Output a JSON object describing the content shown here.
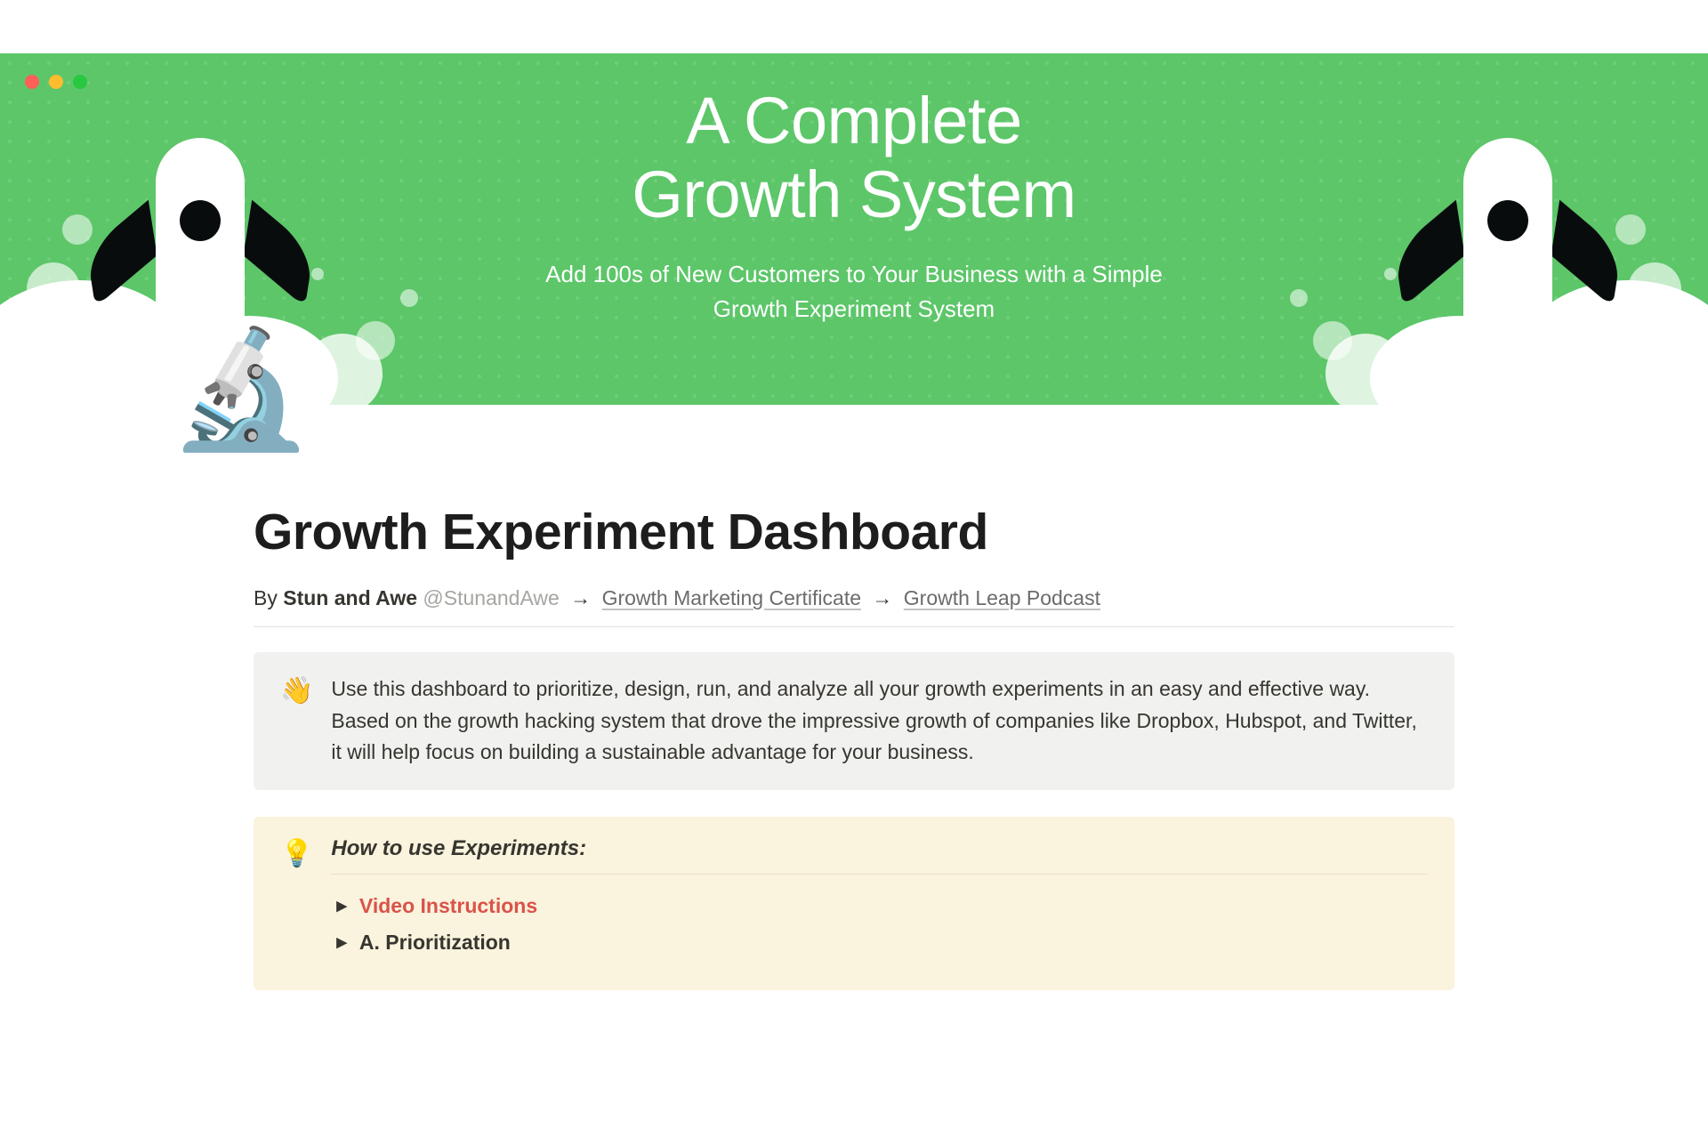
{
  "hero": {
    "title_line1": "A Complete",
    "title_line2": "Growth System",
    "subtitle_line1": "Add 100s of New Customers to Your Business with a Simple",
    "subtitle_line2": "Growth  Experiment System"
  },
  "page_icon": "🔬",
  "page_title": "Growth Experiment Dashboard",
  "byline": {
    "by": "By ",
    "author": "Stun and Awe",
    "handle": " @StunandAwe ",
    "arrow": "→",
    "link1": "Growth Marketing Certificate",
    "link2": "Growth Leap Podcast"
  },
  "callout_intro": {
    "emoji": "👋",
    "text": "Use this dashboard to prioritize, design, run, and analyze all your growth experiments in an easy and effective way. Based on the growth hacking system that drove the impressive growth of companies like Dropbox, Hubspot, and Twitter, it will help focus on building a sustainable advantage for your business."
  },
  "callout_howto": {
    "emoji": "💡",
    "title": "How to use Experiments:",
    "items": [
      {
        "label": "Video Instructions",
        "emphasis": "red"
      },
      {
        "label": "A. Prioritization",
        "emphasis": "normal"
      }
    ]
  }
}
